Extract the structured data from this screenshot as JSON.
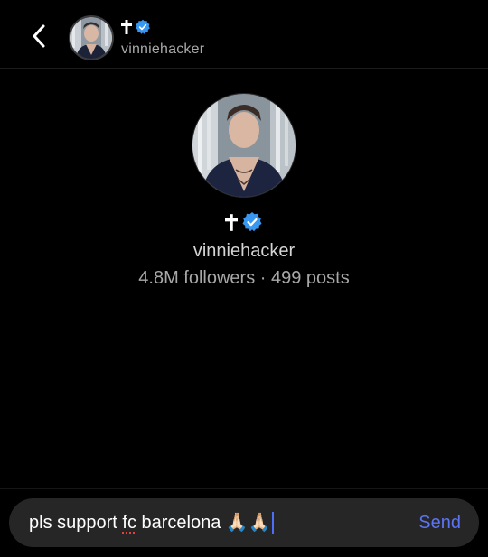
{
  "header": {
    "back_icon": "chevron-left-icon",
    "username": "vinniehacker",
    "badges": [
      "cross-icon",
      "verified-badge-icon"
    ]
  },
  "profile": {
    "username": "vinniehacker",
    "stats": "4.8M followers · 499 posts",
    "badges": [
      "cross-icon",
      "verified-badge-icon"
    ]
  },
  "composer": {
    "text_before": "pls support ",
    "misspelled": "fc",
    "text_after": " barcelona ",
    "emoji": "🙏🏻🙏🏻",
    "send_label": "Send"
  },
  "colors": {
    "background": "#000000",
    "accent": "#5b74f6",
    "verified": "#3897f0",
    "muted_text": "#a8a8a8",
    "composer_bg": "#262626"
  }
}
